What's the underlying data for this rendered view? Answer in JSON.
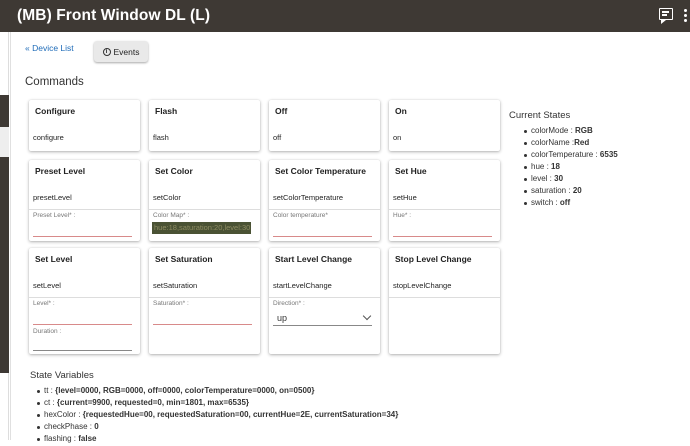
{
  "header": {
    "title": "(MB) Front Window DL (L)"
  },
  "nav": {
    "device_list": "« Device List",
    "events": "Events"
  },
  "commands_title": "Commands",
  "commands": [
    {
      "name": "Configure",
      "cmd": "configure"
    },
    {
      "name": "Flash",
      "cmd": "flash"
    },
    {
      "name": "Off",
      "cmd": "off"
    },
    {
      "name": "On",
      "cmd": "on"
    },
    {
      "name": "Preset Level",
      "cmd": "presetLevel",
      "fields": [
        "Preset Level* :"
      ]
    },
    {
      "name": "Set Color",
      "cmd": "setColor",
      "fields": [
        "Color Map* :"
      ],
      "color_map_value": "hue:18,saturation:20,level:30"
    },
    {
      "name": "Set Color Temperature",
      "cmd": "setColorTemperature",
      "fields": [
        "Color temperature*"
      ]
    },
    {
      "name": "Set Hue",
      "cmd": "setHue",
      "fields": [
        "Hue* :"
      ]
    },
    {
      "name": "Set Level",
      "cmd": "setLevel",
      "fields": [
        "Level* :",
        "Duration :"
      ]
    },
    {
      "name": "Set Saturation",
      "cmd": "setSaturation",
      "fields": [
        "Saturation* :"
      ]
    },
    {
      "name": "Start Level Change",
      "cmd": "startLevelChange",
      "fields": [
        "Direction* :"
      ],
      "direction_value": "up"
    },
    {
      "name": "Stop Level Change",
      "cmd": "stopLevelChange"
    }
  ],
  "current_states": {
    "title": "Current States",
    "items": [
      {
        "key": "colorMode : ",
        "value": "RGB"
      },
      {
        "key": "colorName :",
        "value": "Red"
      },
      {
        "key": "colorTemperature : ",
        "value": "6535"
      },
      {
        "key": "hue : ",
        "value": "18"
      },
      {
        "key": "level : ",
        "value": "30"
      },
      {
        "key": "saturation : ",
        "value": "20"
      },
      {
        "key": "switch : ",
        "value": "off"
      }
    ]
  },
  "state_variables": {
    "title": "State Variables",
    "items": [
      {
        "key": "tt : ",
        "value": "{level=0000, RGB=0000, off=0000, colorTemperature=0000, on=0500}"
      },
      {
        "key": "ct : ",
        "value": "{current=9900, requested=0, min=1801, max=6535}"
      },
      {
        "key": "hexColor : ",
        "value": "{requestedHue=00, requestedSaturation=00, currentHue=2E, currentSaturation=34}"
      },
      {
        "key": "checkPhase : ",
        "value": "0"
      },
      {
        "key": "flashing : ",
        "value": "false"
      }
    ]
  },
  "colors": {
    "topbar": "#3e3934",
    "link": "#1e6bb8",
    "colormap_bg": "#4a5234"
  }
}
